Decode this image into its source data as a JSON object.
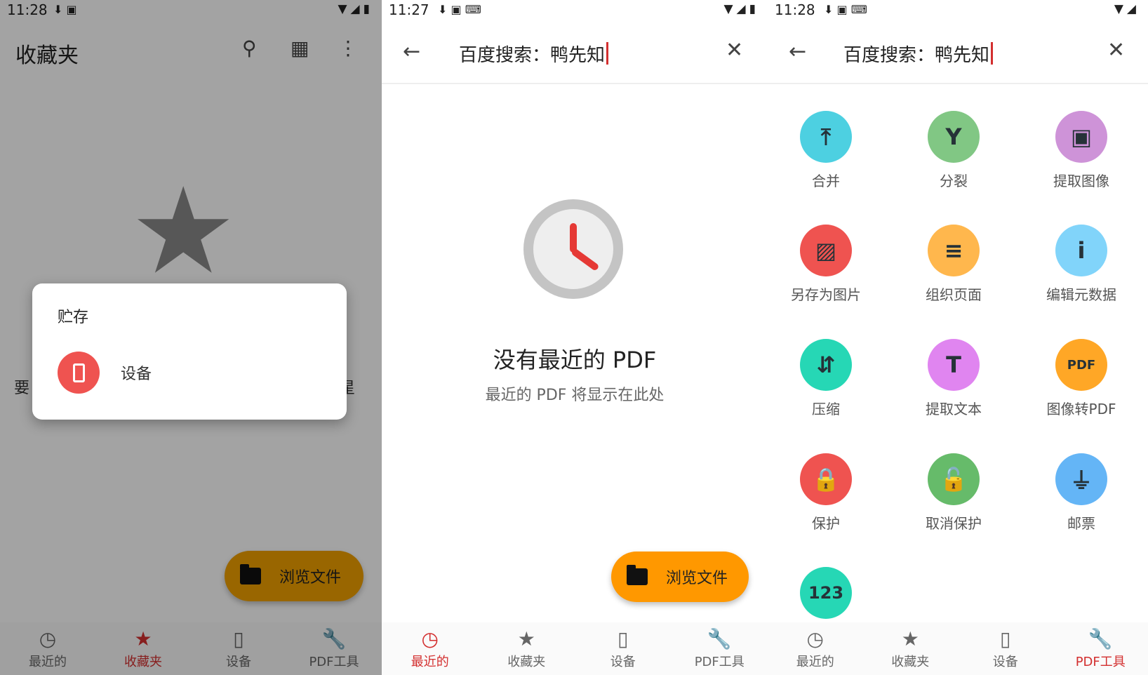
{
  "panel1": {
    "status": {
      "time": "11:28"
    },
    "appbar": {
      "title": "收藏夹"
    },
    "empty_left": "要",
    "empty_right": "星",
    "dialog": {
      "title": "贮存",
      "item_label": "设备"
    },
    "fab_label": "浏览文件",
    "nav": [
      {
        "label": "最近的",
        "icon": "clock-icon"
      },
      {
        "label": "收藏夹",
        "icon": "star-icon",
        "active": true
      },
      {
        "label": "设备",
        "icon": "phone-icon"
      },
      {
        "label": "PDF工具",
        "icon": "wrench-icon"
      }
    ]
  },
  "panel2": {
    "status": {
      "time": "11:27"
    },
    "search": {
      "query": "百度搜索：鸭先知"
    },
    "empty_title": "没有最近的 PDF",
    "empty_subtitle": "最近的 PDF 将显示在此处",
    "fab_label": "浏览文件",
    "nav": [
      {
        "label": "最近的",
        "icon": "clock-icon",
        "active": true
      },
      {
        "label": "收藏夹",
        "icon": "star-icon"
      },
      {
        "label": "设备",
        "icon": "phone-icon"
      },
      {
        "label": "PDF工具",
        "icon": "wrench-icon"
      }
    ]
  },
  "panel3": {
    "status": {
      "time": "11:28"
    },
    "search": {
      "query": "百度搜索：鸭先知"
    },
    "tools": [
      {
        "label": "合并",
        "glyph": "⤒",
        "color": "#4dd0e1",
        "icon": "merge-icon"
      },
      {
        "label": "分裂",
        "glyph": "Y",
        "color": "#81c784",
        "icon": "split-icon"
      },
      {
        "label": "提取图像",
        "glyph": "▣",
        "color": "#ce93d8",
        "icon": "image-extract-icon"
      },
      {
        "label": "另存为图片",
        "glyph": "▨",
        "color": "#ef5350",
        "icon": "save-image-icon"
      },
      {
        "label": "组织页面",
        "glyph": "≡",
        "color": "#ffb74d",
        "icon": "organize-icon"
      },
      {
        "label": "编辑元数据",
        "glyph": "i",
        "color": "#81d4fa",
        "icon": "info-icon"
      },
      {
        "label": "压缩",
        "glyph": "⇵",
        "color": "#26d7b5",
        "icon": "compress-icon"
      },
      {
        "label": "提取文本",
        "glyph": "T",
        "color": "#e085f0",
        "icon": "text-icon"
      },
      {
        "label": "图像转PDF",
        "glyph": "PDF",
        "color": "#ffa726",
        "icon": "pdf-icon"
      },
      {
        "label": "保护",
        "glyph": "🔒",
        "color": "#ef5350",
        "icon": "lock-icon"
      },
      {
        "label": "取消保护",
        "glyph": "🔓",
        "color": "#66bb6a",
        "icon": "unlock-icon"
      },
      {
        "label": "邮票",
        "glyph": "⏚",
        "color": "#64b5f6",
        "icon": "stamp-icon"
      },
      {
        "label": "",
        "glyph": "123",
        "color": "#26d7b5",
        "icon": "page-number-icon"
      }
    ],
    "nav": [
      {
        "label": "最近的",
        "icon": "clock-icon"
      },
      {
        "label": "收藏夹",
        "icon": "star-icon"
      },
      {
        "label": "设备",
        "icon": "phone-icon"
      },
      {
        "label": "PDF工具",
        "icon": "wrench-icon",
        "active": true
      }
    ]
  }
}
